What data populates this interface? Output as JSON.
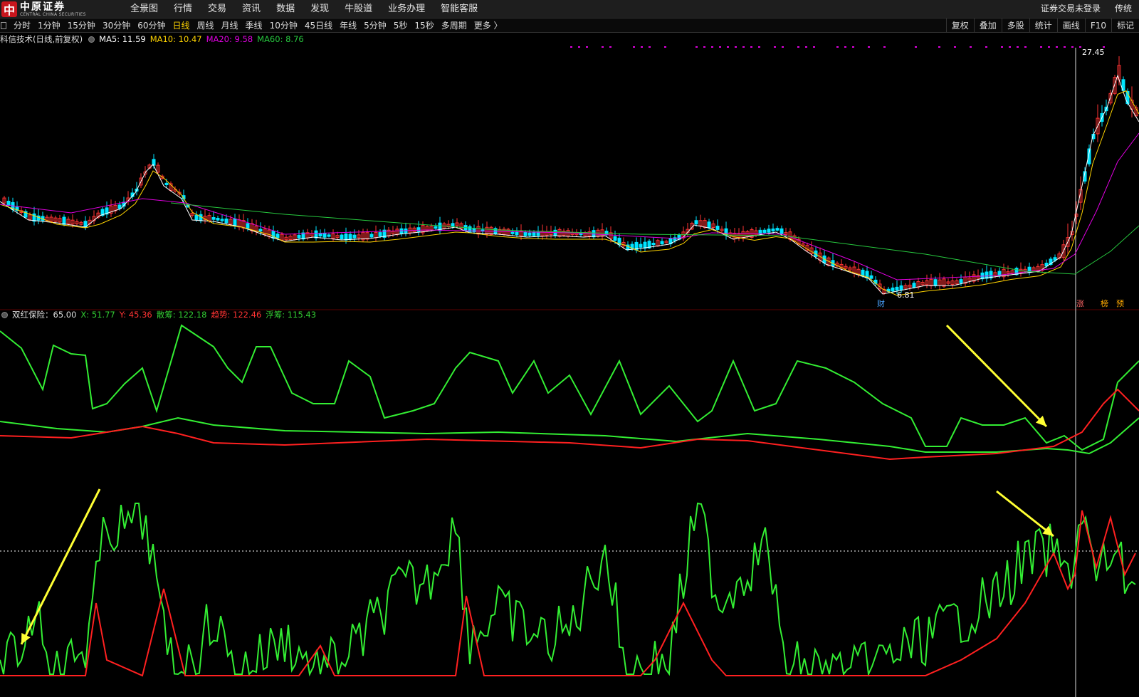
{
  "app": {
    "logo_text": "中原证券",
    "logo_sub": "CENTRAL CHINA SECURITIES",
    "nav": [
      "全景图",
      "行情",
      "交易",
      "资讯",
      "数据",
      "发现",
      "牛股道",
      "业务办理",
      "智能客服"
    ],
    "top_right": [
      "证券交易未登录",
      "传统"
    ]
  },
  "periods": {
    "tabs": [
      "分时",
      "1分钟",
      "15分钟",
      "30分钟",
      "60分钟",
      "日线",
      "周线",
      "月线",
      "季线",
      "10分钟",
      "45日线",
      "年线",
      "5分钟",
      "5秒",
      "15秒",
      "多周期",
      "更多 〉"
    ],
    "active": "日线"
  },
  "tools": [
    "复权",
    "叠加",
    "多股",
    "统计",
    "画线",
    "F10",
    "标记"
  ],
  "price_panel": {
    "title": "科信技术(日线,前复权)",
    "ma": [
      {
        "label": "MA5: 11.59",
        "color": "#ffffff"
      },
      {
        "label": "MA10: 10.47",
        "color": "#ffd400"
      },
      {
        "label": "MA20: 9.58",
        "color": "#e100e1"
      },
      {
        "label": "MA60: 8.76",
        "color": "#27c93f"
      }
    ],
    "high_label": "27.45",
    "low_label": "6.81",
    "event_labels": [
      "财",
      "涨",
      "榜",
      "预"
    ]
  },
  "indicator_panel": {
    "title": "双红保险：65.00",
    "items": [
      {
        "label": "X: 51.77",
        "color": "#33cc33"
      },
      {
        "label": "Y: 45.36",
        "color": "#ff3333"
      },
      {
        "label": "散筹: 122.18",
        "color": "#33cc33"
      },
      {
        "label": "趋势: 122.46",
        "color": "#ff3333"
      },
      {
        "label": "浮筹: 115.43",
        "color": "#33cc33"
      }
    ]
  },
  "colors": {
    "up": "#ff3333",
    "down": "#00e5ff",
    "ma5": "#ffffff",
    "ma10": "#ffd400",
    "ma20": "#e100e1",
    "ma60": "#27c93f",
    "ind_green": "#33ee33",
    "ind_red": "#ff2020",
    "arrow": "#ffff33",
    "active_tab": "#ffd400"
  }
}
